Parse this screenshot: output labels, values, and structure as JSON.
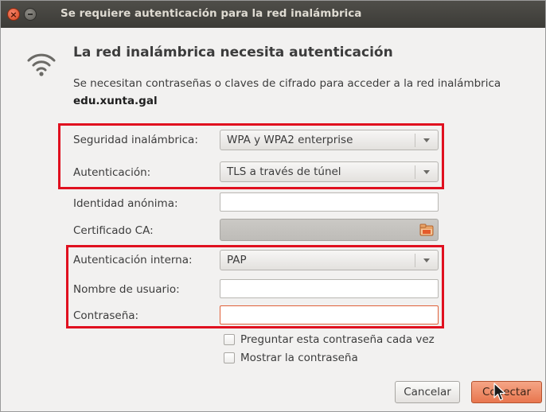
{
  "window": {
    "title": "Se requiere autenticación para la red inalámbrica",
    "close_glyph": "×"
  },
  "header": {
    "heading": "La red inalámbrica necesita autenticación",
    "description": "Se necesitan contraseñas o claves de cifrado para acceder a la red inalámbrica",
    "network_name": "edu.xunta.gal",
    "icon": "wifi-icon"
  },
  "form": {
    "security_label": "Seguridad inalámbrica:",
    "security_value": "WPA y WPA2 enterprise",
    "auth_label": "Autenticación:",
    "auth_value": "TLS a través de túnel",
    "anon_identity_label": "Identidad anónima:",
    "anon_identity_value": "",
    "ca_cert_label": "Certificado CA:",
    "ca_cert_value": "",
    "inner_auth_label": "Autenticación interna:",
    "inner_auth_value": "PAP",
    "username_label": "Nombre de usuario:",
    "username_value": "",
    "password_label": "Contraseña:",
    "password_value": ""
  },
  "options": {
    "ask_each_time_label": "Preguntar esta contraseña cada vez",
    "ask_each_time_checked": false,
    "show_password_label": "Mostrar la contraseña",
    "show_password_checked": false
  },
  "buttons": {
    "cancel_label": "Cancelar",
    "connect_label": "Conectar"
  },
  "colors": {
    "titlebar": "#3c3b37",
    "highlight_box": "#e0101f",
    "accent_button": "#e8764f",
    "dialog_bg": "#f2f1f0"
  }
}
